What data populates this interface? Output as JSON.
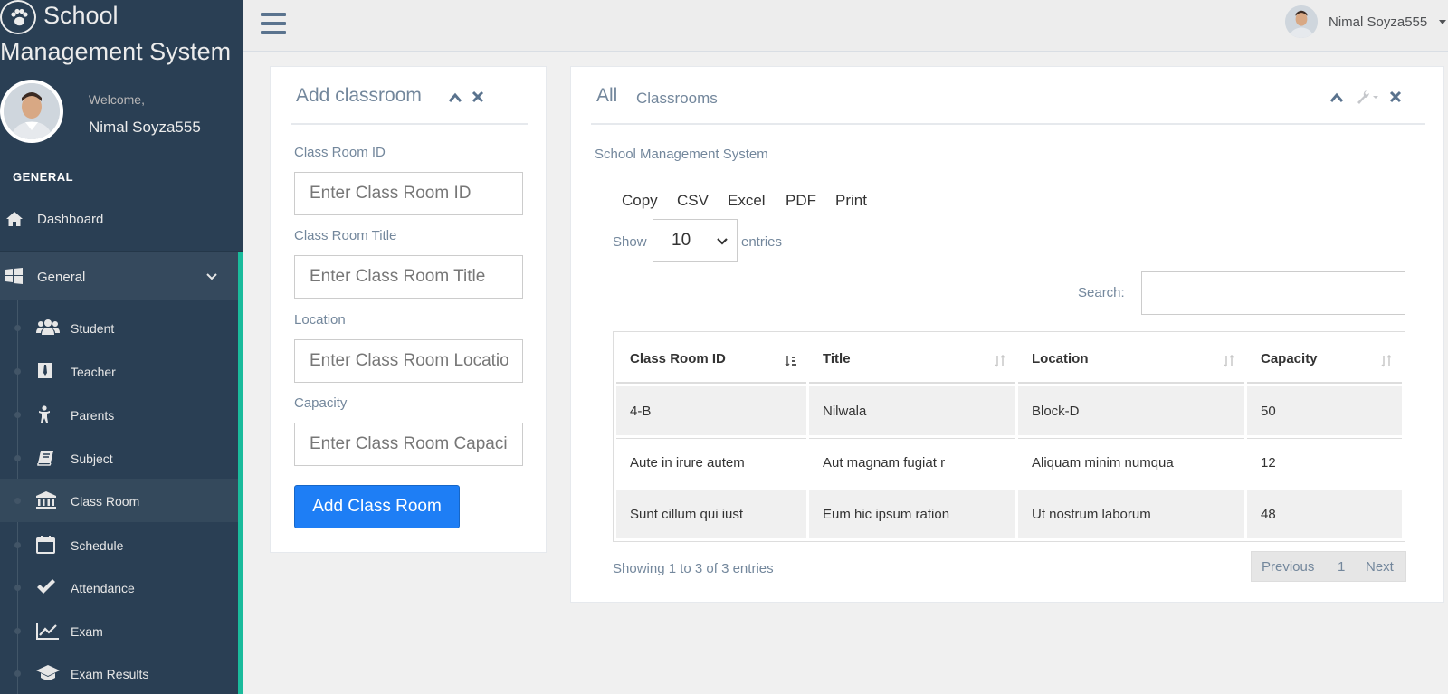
{
  "app": {
    "brand_line1": "School",
    "brand_line2": "Management System"
  },
  "profile": {
    "welcome": "Welcome,",
    "name": "Nimal Soyza555"
  },
  "sidebar": {
    "section_title": "GENERAL",
    "dashboard_label": "Dashboard",
    "general_label": "General",
    "items": [
      {
        "label": "Student",
        "icon": "users-icon"
      },
      {
        "label": "Teacher",
        "icon": "tie-icon"
      },
      {
        "label": "Parents",
        "icon": "child-icon"
      },
      {
        "label": "Subject",
        "icon": "book-icon"
      },
      {
        "label": "Class Room",
        "icon": "bank-icon"
      },
      {
        "label": "Schedule",
        "icon": "calendar-icon"
      },
      {
        "label": "Attendance",
        "icon": "check-icon"
      },
      {
        "label": "Exam",
        "icon": "line-chart-icon"
      },
      {
        "label": "Exam Results",
        "icon": "graduation-cap-icon"
      }
    ],
    "active_item": "Class Room"
  },
  "topbar": {
    "user_name": "Nimal Soyza555"
  },
  "add_form": {
    "title": "Add classroom",
    "fields": [
      {
        "label": "Class Room ID",
        "placeholder": "Enter Class Room ID"
      },
      {
        "label": "Class Room Title",
        "placeholder": "Enter Class Room Title"
      },
      {
        "label": "Location",
        "placeholder": "Enter Class Room Location"
      },
      {
        "label": "Capacity",
        "placeholder": "Enter Class Room Capacity"
      }
    ],
    "submit_label": "Add Class Room"
  },
  "list_panel": {
    "title": "All",
    "subtitle": "Classrooms",
    "caption": "School Management System",
    "export_buttons": [
      "Copy",
      "CSV",
      "Excel",
      "PDF",
      "Print"
    ],
    "show_label": "Show",
    "entries_value": "10",
    "entries_label": "entries",
    "search_label": "Search:",
    "columns": [
      "Class Room ID",
      "Title",
      "Location",
      "Capacity"
    ],
    "rows": [
      [
        "4-B",
        "Nilwala",
        "Block-D",
        "50"
      ],
      [
        "Aute in irure autem",
        "Aut magnam fugiat r",
        "Aliquam minim numqua",
        "12"
      ],
      [
        "Sunt cillum qui iust",
        "Eum hic ipsum ration",
        "Ut nostrum laborum",
        "48"
      ]
    ],
    "info": "Showing 1 to 3 of 3 entries",
    "pager": {
      "previous": "Previous",
      "page": "1",
      "next": "Next"
    }
  },
  "colors": {
    "sidebar_bg": "#2a3f54",
    "accent_green": "#1abb9c",
    "primary_button": "#1e7ef5"
  }
}
